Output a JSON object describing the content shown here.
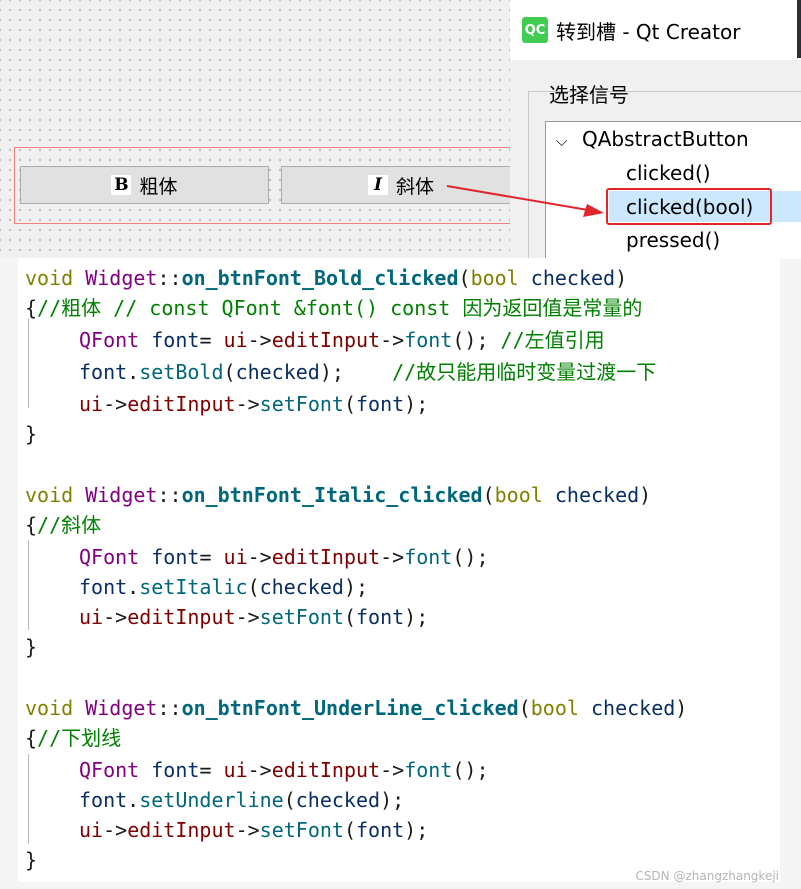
{
  "designer": {
    "bold_button": {
      "icon": "B",
      "label": "粗体"
    },
    "italic_button": {
      "icon": "I",
      "label": "斜体"
    }
  },
  "dialog": {
    "logo": "QC",
    "title": "转到槽 - Qt Creator",
    "group_label": "选择信号",
    "tree_group": "QAbstractButton",
    "items": [
      "clicked()",
      "clicked(bool)",
      "pressed()"
    ],
    "selected_index": 1
  },
  "code": {
    "l01": [
      "void",
      " ",
      "Widget",
      "::",
      "on_btnFont_Bold_clicked",
      "(",
      "bool",
      " ",
      "checked",
      ")"
    ],
    "l02": [
      "{",
      "//粗体 // const QFont &font() const 因为返回值是常量的"
    ],
    "l03": [
      "QFont",
      " ",
      "font",
      "= ",
      "ui",
      "->",
      "editInput",
      "->",
      "font",
      "(); ",
      "//左值引用"
    ],
    "l04": [
      "font",
      ".",
      "setBold",
      "(",
      "checked",
      ");    ",
      "//故只能用临时变量过渡一下"
    ],
    "l05": [
      "ui",
      "->",
      "editInput",
      "->",
      "setFont",
      "(",
      "font",
      ");"
    ],
    "l06": "}",
    "l08": [
      "void",
      " ",
      "Widget",
      "::",
      "on_btnFont_Italic_clicked",
      "(",
      "bool",
      " ",
      "checked",
      ")"
    ],
    "l09": [
      "{",
      "//斜体"
    ],
    "l10": [
      "QFont",
      " ",
      "font",
      "= ",
      "ui",
      "->",
      "editInput",
      "->",
      "font",
      "();"
    ],
    "l11": [
      "font",
      ".",
      "setItalic",
      "(",
      "checked",
      ");"
    ],
    "l12": [
      "ui",
      "->",
      "editInput",
      "->",
      "setFont",
      "(",
      "font",
      ");"
    ],
    "l13": "}",
    "l15": [
      "void",
      " ",
      "Widget",
      "::",
      "on_btnFont_UnderLine_clicked",
      "(",
      "bool",
      " ",
      "checked",
      ")"
    ],
    "l16": [
      "{",
      "//下划线"
    ],
    "l17": [
      "QFont",
      " ",
      "font",
      "= ",
      "ui",
      "->",
      "editInput",
      "->",
      "font",
      "();"
    ],
    "l18": [
      "font",
      ".",
      "setUnderline",
      "(",
      "checked",
      ");"
    ],
    "l19": [
      "ui",
      "->",
      "editInput",
      "->",
      "setFont",
      "(",
      "font",
      ");"
    ],
    "l20": "}"
  },
  "watermark": "CSDN @zhangzhangkeji",
  "colors": {
    "keyword": "#808000",
    "class": "#800080",
    "function": "#00677c",
    "comment": "#008000",
    "selection_box": "#e0252b",
    "selection_bg": "#cce8ff"
  }
}
